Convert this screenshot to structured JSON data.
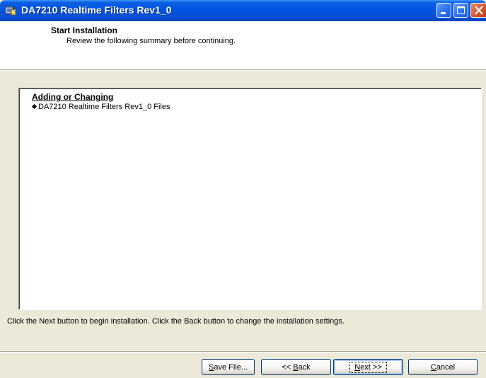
{
  "window": {
    "title": "DA7210 Realtime Filters Rev1_0",
    "titlebar_color": "#0054e3",
    "controls": [
      "minimize-icon",
      "maximize-icon",
      "close-icon"
    ]
  },
  "header": {
    "title": "Start Installation",
    "subtitle": "Review the following summary before continuing."
  },
  "summary": {
    "heading": "Adding or Changing",
    "items": [
      "DA7210 Realtime Filters Rev1_0 Files"
    ]
  },
  "instructions": "Click the Next button to begin installation.  Click the Back button to change the installation settings.",
  "buttons": {
    "save": {
      "prefix": "",
      "key": "S",
      "rest": "ave File..."
    },
    "back": {
      "prefix": "<< ",
      "key": "B",
      "rest": "ack"
    },
    "next": {
      "prefix": "",
      "key": "N",
      "rest": "ext >>"
    },
    "cancel": {
      "prefix": "",
      "key": "C",
      "rest": "ancel"
    }
  }
}
